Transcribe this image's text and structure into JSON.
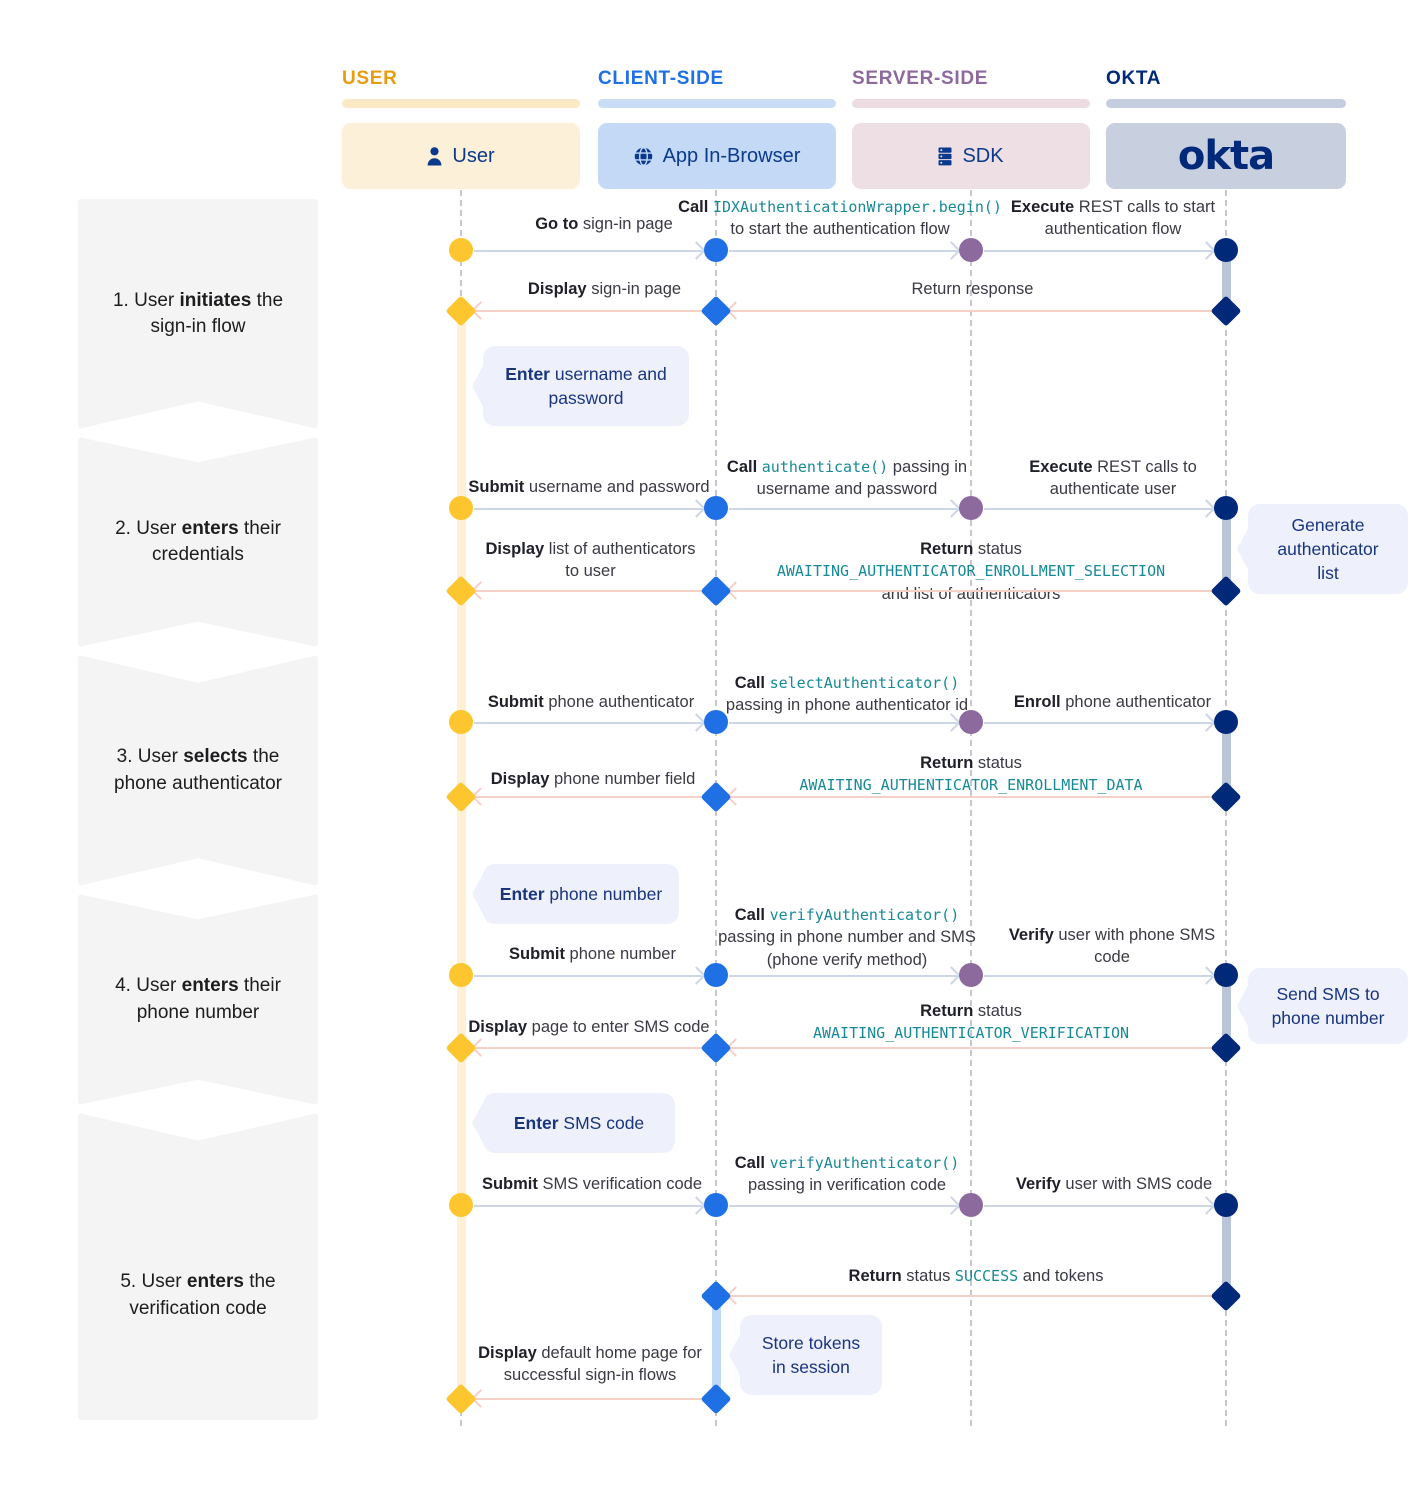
{
  "steps": [
    {
      "num": "1.",
      "lead": "User ",
      "bold": "initiates",
      "tail": " the sign-in flow"
    },
    {
      "num": "2.",
      "lead": "User ",
      "bold": "enters",
      "tail": " their credentials"
    },
    {
      "num": "3.",
      "lead": "User ",
      "bold": "selects",
      "tail": " the phone authenticator"
    },
    {
      "num": "4.",
      "lead": "User ",
      "bold": "enters",
      "tail": " their phone number"
    },
    {
      "num": "5.",
      "lead": "User ",
      "bold": "enters",
      "tail": " the verification code"
    }
  ],
  "lanes": [
    {
      "title": "USER",
      "color": "#e89c10",
      "bar": "#fbe9c6",
      "box": "#fdf0d8",
      "label": "User",
      "icon": "person-icon"
    },
    {
      "title": "CLIENT-SIDE",
      "color": "#1f6fe5",
      "bar": "#c9ddf7",
      "box": "#c3d9f6",
      "label": "App In-Browser",
      "icon": "globe-icon"
    },
    {
      "title": "SERVER-SIDE",
      "color": "#8c6a9e",
      "bar": "#eddde3",
      "box": "#eddfe4",
      "label": "SDK",
      "icon": "server-stack-icon"
    },
    {
      "title": "OKTA",
      "color": "#00297a",
      "bar": "#c5cede",
      "box": "#c8d0e0",
      "label": "okta",
      "icon": "okta-logo"
    }
  ],
  "messages": {
    "m1": {
      "b": "Go to",
      "t": " sign-in page"
    },
    "m2": {
      "b": "Call ",
      "code": "IDXAuthenticationWrapper.begin()",
      "t2": "to start the authentication flow"
    },
    "m3": {
      "b": "Execute",
      "t": " REST calls to start authentication flow"
    },
    "m4": {
      "b": "Display",
      "t": " sign-in page"
    },
    "m5": {
      "t": "Return response"
    },
    "m6": {
      "b": "Submit",
      "t": " username and password"
    },
    "m7": {
      "b": "Call ",
      "code": "authenticate()",
      "t": " passing in",
      "t2": "username and password"
    },
    "m8": {
      "b": "Execute",
      "t": " REST calls to authenticate user"
    },
    "m9": {
      "b": "Display",
      "t": " list of authenticators to user"
    },
    "m10": {
      "b": "Return",
      "t": " status ",
      "code": "AWAITING_AUTHENTICATOR_ENROLLMENT_SELECTION",
      "t2": "and list of authenticators"
    },
    "m11": {
      "b": "Submit",
      "t": " phone authenticator"
    },
    "m12": {
      "b": "Call ",
      "code": "selectAuthenticator()",
      "t2": "passing in phone authenticator id"
    },
    "m13": {
      "b": "Enroll",
      "t": " phone authenticator"
    },
    "m14": {
      "b": "Display",
      "t": " phone number field"
    },
    "m15": {
      "b": "Return",
      "t": " status",
      "code2": "AWAITING_AUTHENTICATOR_ENROLLMENT_DATA"
    },
    "m16": {
      "b": "Submit",
      "t": " phone number"
    },
    "m17": {
      "b": "Call ",
      "code": "verifyAuthenticator()",
      "t2": "passing in phone number and SMS",
      "t3": "(phone verify method)"
    },
    "m18": {
      "b": "Verify",
      "t": " user with phone SMS code"
    },
    "m19": {
      "b": "Display",
      "t": " page to enter SMS code"
    },
    "m20": {
      "b": "Return",
      "t": " status",
      "code2": "AWAITING_AUTHENTICATOR_VERIFICATION"
    },
    "m21": {
      "b": "Submit",
      "t": " SMS verification code"
    },
    "m22": {
      "b": "Call ",
      "code": "verifyAuthenticator()",
      "t2": "passing in verification code"
    },
    "m23": {
      "b": "Verify",
      "t": " user with SMS code"
    },
    "m24": {
      "b": "Return",
      "t": " status ",
      "code": "SUCCESS",
      "t4": " and tokens"
    },
    "m25": {
      "b": "Display",
      "t": " default home page for successful sign-in flows"
    }
  },
  "callouts": {
    "c1": {
      "bold": "Enter",
      "rest": " username and password"
    },
    "c2": {
      "line1": "Generate",
      "line2": "authenticator",
      "line3": "list"
    },
    "c3": {
      "bold": "Enter",
      "rest": " phone number"
    },
    "c4": {
      "line1": "Send SMS to",
      "line2": "phone number"
    },
    "c5": {
      "bold": "Enter",
      "rest": " SMS code"
    },
    "c6": {
      "line1": "Store tokens",
      "line2": "in session"
    }
  },
  "colors": {
    "user": "#fdc62e",
    "client": "#1f6fe5",
    "server": "#8c6a9e",
    "okta": "#00297a",
    "arrow_forward": "#ccd6e6",
    "arrow_back": "#f6cfc7",
    "activation_user": "#fdf0d4",
    "activation_client": "#bfd9f7",
    "activation_okta": "#bac5d8",
    "callout_bg": "#eef0fb",
    "code_text": "#178a98",
    "step_bg": "#f4f4f4"
  }
}
